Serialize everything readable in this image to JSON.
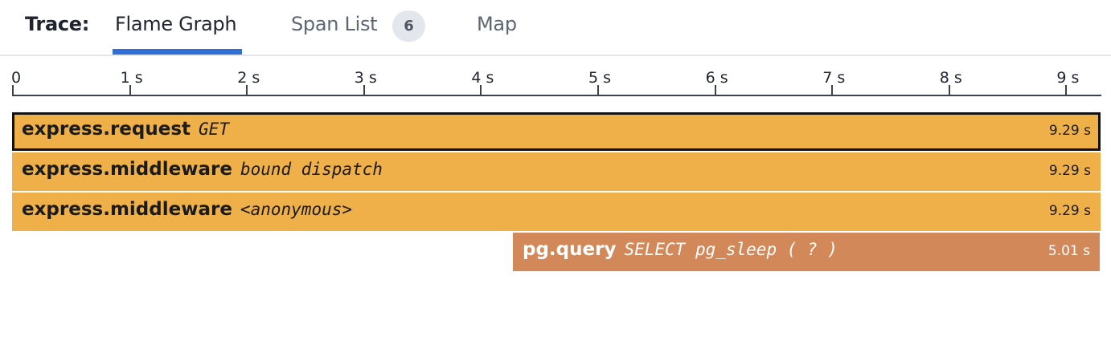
{
  "header": {
    "trace_label": "Trace:",
    "tabs": [
      {
        "label": "Flame Graph",
        "active": true
      },
      {
        "label": "Span List",
        "count": "6",
        "active": false
      },
      {
        "label": "Map",
        "active": false
      }
    ]
  },
  "axis": {
    "ticks": [
      "0",
      "1 s",
      "2 s",
      "3 s",
      "4 s",
      "5 s",
      "6 s",
      "7 s",
      "8 s",
      "9 s"
    ]
  },
  "spans": [
    {
      "name": "express.request",
      "resource": "GET",
      "duration": "9.29 s",
      "start_s": 0,
      "duration_s": 9.29,
      "selected": true
    },
    {
      "name": "express.middleware",
      "resource": "bound dispatch",
      "duration": "9.29 s",
      "start_s": 0,
      "duration_s": 9.29,
      "selected": false
    },
    {
      "name": "express.middleware",
      "resource": "<anonymous>",
      "duration": "9.29 s",
      "start_s": 0,
      "duration_s": 9.29,
      "selected": false
    },
    {
      "name": "pg.query",
      "resource": "SELECT pg_sleep ( ? )",
      "duration": "5.01 s",
      "start_s": 4.28,
      "duration_s": 5.01,
      "selected": false
    }
  ],
  "colors": {
    "accent": "#2f6fd6",
    "express_span": "#efb04a",
    "pg_span": "#d3885a",
    "selected_border": "#111111"
  }
}
